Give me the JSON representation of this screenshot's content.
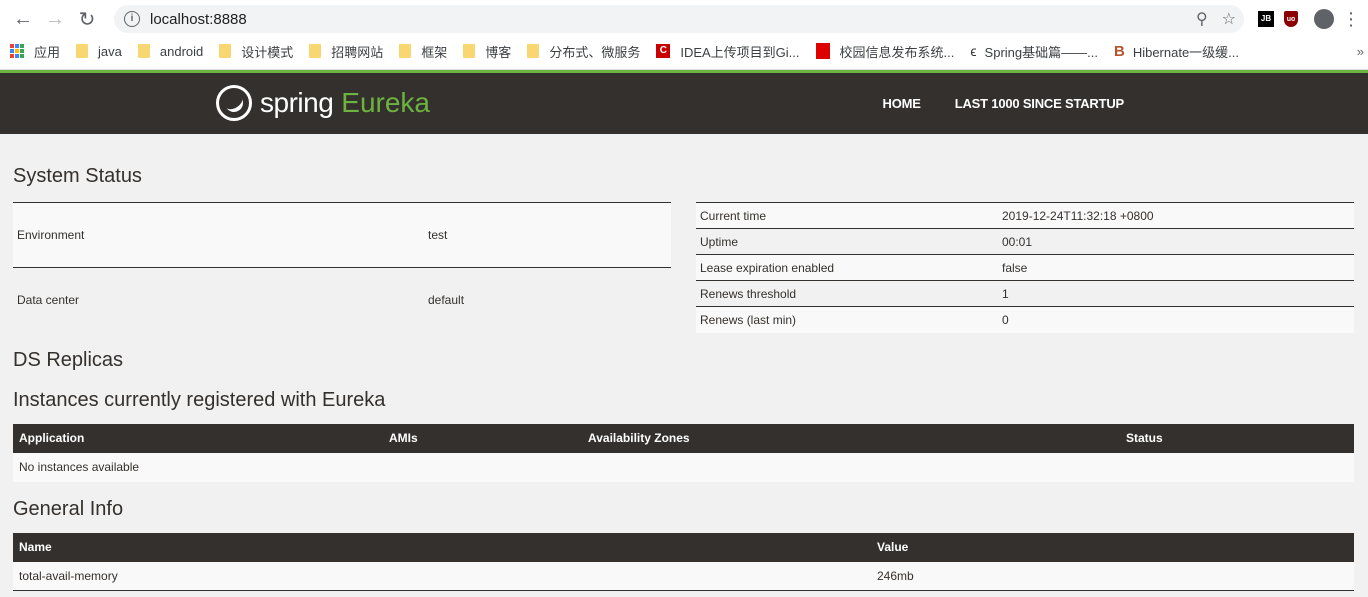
{
  "browser": {
    "url": "localhost:8888",
    "bookmarks": [
      {
        "label": "应用",
        "icon": "apps-grid-icon"
      },
      {
        "label": "java",
        "icon": "folder-icon"
      },
      {
        "label": "android",
        "icon": "folder-icon"
      },
      {
        "label": "设计模式",
        "icon": "folder-icon"
      },
      {
        "label": "招聘网站",
        "icon": "folder-icon"
      },
      {
        "label": "框架",
        "icon": "folder-icon"
      },
      {
        "label": "博客",
        "icon": "folder-icon"
      },
      {
        "label": "分布式、微服务",
        "icon": "folder-icon"
      },
      {
        "label": "IDEA上传项目到Gi...",
        "icon": "csdn-icon"
      },
      {
        "label": "校园信息发布系统...",
        "icon": "school-icon"
      },
      {
        "label": "Spring基础篇——...",
        "icon": "spring-icon"
      },
      {
        "label": "Hibernate一级缓...",
        "icon": "hibernate-icon"
      }
    ],
    "more_bookmarks": "»",
    "ext_jb": "JB",
    "ext_ub": "uo"
  },
  "navbar": {
    "brand_word": "spring",
    "brand_accent": "Eureka",
    "links": [
      "HOME",
      "LAST 1000 SINCE STARTUP"
    ]
  },
  "system_status": {
    "title": "System Status",
    "left": [
      [
        "Environment",
        "test"
      ],
      [
        "Data center",
        "default"
      ]
    ],
    "right": [
      [
        "Current time",
        "2019-12-24T11:32:18 +0800"
      ],
      [
        "Uptime",
        "00:01"
      ],
      [
        "Lease expiration enabled",
        "false"
      ],
      [
        "Renews threshold",
        "1"
      ],
      [
        "Renews (last min)",
        "0"
      ]
    ]
  },
  "ds_replicas": {
    "title": "DS Replicas"
  },
  "instances": {
    "title": "Instances currently registered with Eureka",
    "columns": [
      "Application",
      "AMIs",
      "Availability Zones",
      "Status"
    ],
    "empty_text": "No instances available"
  },
  "general_info": {
    "title": "General Info",
    "columns": [
      "Name",
      "Value"
    ],
    "rows": [
      [
        "total-avail-memory",
        "246mb"
      ]
    ]
  },
  "colors": {
    "navbar_bg": "#34302d",
    "accent_green": "#6db33f",
    "page_bg": "#f1f1f1"
  }
}
